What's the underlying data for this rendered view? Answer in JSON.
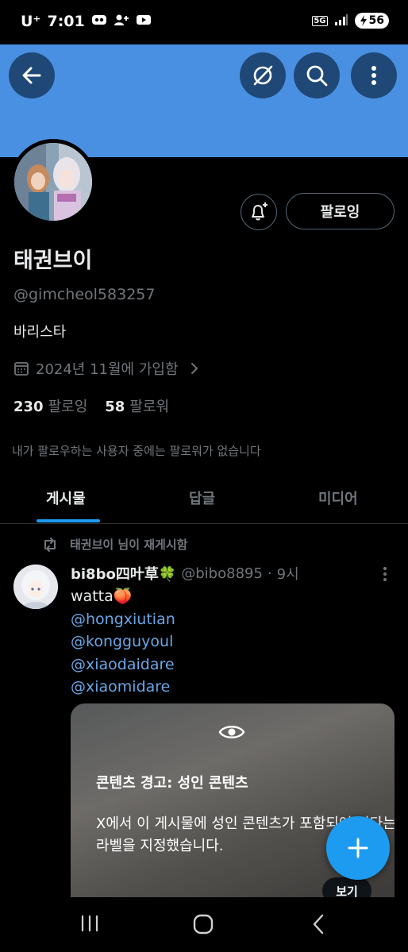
{
  "status_bar": {
    "carrier": "U⁺",
    "time": "7:01",
    "network": "5G",
    "battery": "56"
  },
  "profile": {
    "name": "태권브이",
    "handle": "@gimcheol583257",
    "bio": "바리스타",
    "joined": "2024년 11월에 가입함",
    "following_count": "230",
    "following_label": "팔로잉",
    "followers_count": "58",
    "followers_label": "팔로워",
    "followed_by_note": "내가 팔로우하는 사용자 중에는 팔로워가 없습니다",
    "follow_button_label": "팔로잉"
  },
  "tabs": [
    {
      "label": "게시물",
      "active": true
    },
    {
      "label": "답글",
      "active": false
    },
    {
      "label": "미디어",
      "active": false
    }
  ],
  "post": {
    "repost_label": "태권브이 님이 재게시함",
    "author_name": "bi8bo四叶草🍀",
    "author_handle": "@bibo8895",
    "separator": "·",
    "time": "9시",
    "text": "watta🍑",
    "mentions": [
      "@hongxiutian",
      "@kongguyoul",
      "@xiaodaidare",
      "@xiaomidare"
    ],
    "warning_title": "콘텐츠 경고: 성인 콘텐츠",
    "warning_body": "X에서 이 게시물에 성인 콘텐츠가 포함되어 있다는 라벨을 지정했습니다.",
    "view_label": "보기"
  },
  "colors": {
    "banner": "#4a90e2",
    "accent": "#1d9bf0",
    "mention": "#6ba6e6"
  }
}
